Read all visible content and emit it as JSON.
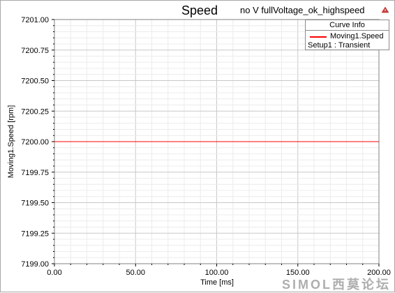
{
  "window": {
    "title": "Speed",
    "subtitle": "no V fullVoltage_ok_highspeed"
  },
  "legend": {
    "header": "Curve Info",
    "series_label": "Moving1.Speed",
    "setup_label": "Setup1 : Transient",
    "swatch_color": "#ff0000"
  },
  "watermark": {
    "text": "SIMOL西莫论坛"
  },
  "chart_data": {
    "type": "line",
    "title": "Speed",
    "subtitle": "no V fullVoltage_ok_highspeed",
    "xlabel": "Time [ms]",
    "ylabel": "Moving1.Speed [rpm]",
    "xlim": [
      0,
      200
    ],
    "ylim": [
      7199.0,
      7201.0
    ],
    "x_ticks": [
      "0.00",
      "50.00",
      "100.00",
      "150.00",
      "200.00"
    ],
    "y_ticks": [
      "7199.00",
      "7199.25",
      "7199.50",
      "7199.75",
      "7200.00",
      "7200.25",
      "7200.50",
      "7200.75",
      "7201.00"
    ],
    "grid": true,
    "legend_position": "top-right",
    "series": [
      {
        "name": "Moving1.Speed",
        "color": "#ff0000",
        "x": [
          0,
          200
        ],
        "y": [
          7200.0,
          7200.0
        ]
      }
    ]
  }
}
